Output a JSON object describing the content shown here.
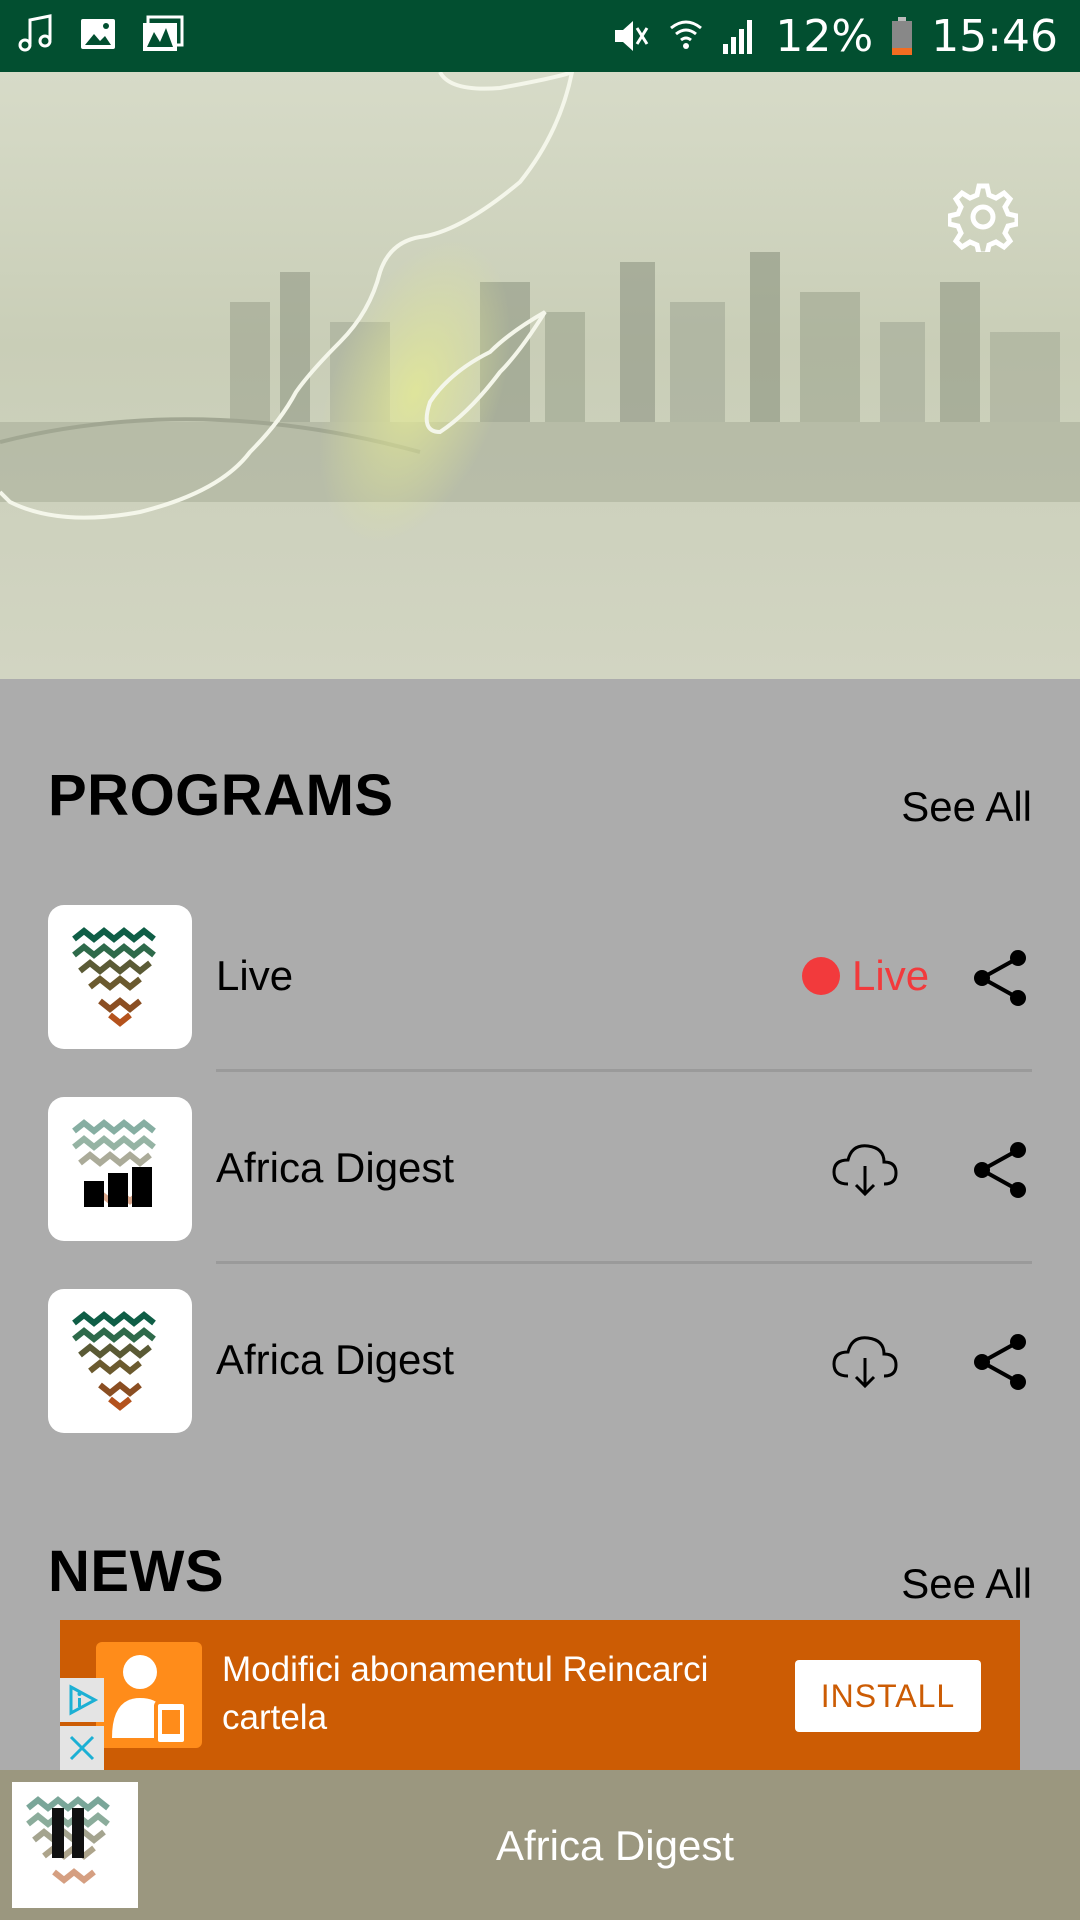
{
  "status_bar": {
    "battery_percent": "12%",
    "time": "15:46",
    "icons": [
      "music-note-icon",
      "image-icon",
      "gallery-icon",
      "mute-icon",
      "wifi-icon",
      "signal-icon",
      "battery-icon"
    ]
  },
  "hero": {
    "settings_icon": "gear-icon"
  },
  "programs": {
    "title": "PROGRAMS",
    "see_all": "See All",
    "items": [
      {
        "title": "Live",
        "status": "Live",
        "action": "share"
      },
      {
        "title": "Africa Digest",
        "action": "download"
      },
      {
        "title": "Africa Digest",
        "action": "download"
      }
    ]
  },
  "news": {
    "title": "NEWS",
    "see_all": "See All"
  },
  "ad": {
    "text": "Modifici abonamentul Reincarci cartela",
    "install_label": "INSTALL"
  },
  "player": {
    "title": "Africa Digest",
    "state": "playing"
  },
  "colors": {
    "status_bar": "#024f30",
    "live_red": "#f23a3c",
    "ad_orange": "#cc5c04",
    "player_bg": "#9b977f"
  }
}
